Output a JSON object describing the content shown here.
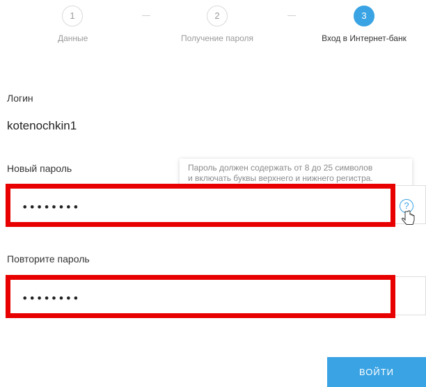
{
  "stepper": {
    "steps": [
      {
        "number": "1",
        "label": "Данные"
      },
      {
        "number": "2",
        "label": "Получение пароля"
      },
      {
        "number": "3",
        "label": "Вход в Интернет-банк"
      }
    ],
    "active_step": 3
  },
  "form": {
    "login_label": "Логин",
    "login_value": "kotenochkin1",
    "new_password_label": "Новый пароль",
    "new_password_value": "••••••••",
    "repeat_password_label": "Повторите пароль",
    "repeat_password_value": "••••••••",
    "tooltip_text_line1": "Пароль должен содержать от 8 до 25 символов",
    "tooltip_text_line2": "и включать буквы верхнего и нижнего регистра.",
    "help_icon_glyph": "?",
    "submit_label": "войти"
  },
  "colors": {
    "accent": "#3aa3e3",
    "highlight": "#e80000"
  }
}
